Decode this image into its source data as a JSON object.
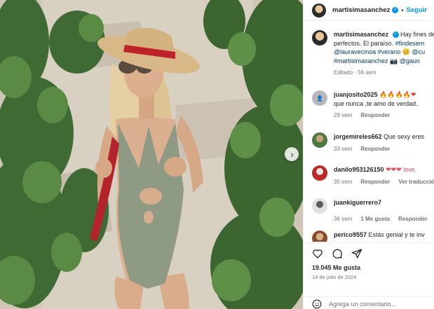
{
  "post": {
    "username": "martisimasanchez",
    "follow_label": "Seguir",
    "dot": "•"
  },
  "comments": [
    {
      "user": "martisimasanchez",
      "text_lines": [
        "Hay fines de",
        "perfectos. El paraíso.",
        "@lauravecinoa #verano",
        "#martisimasanchez"
      ],
      "tags": [
        "#findesem",
        "@cu",
        "@gaun"
      ],
      "emoji": [
        "😊",
        "📷"
      ],
      "time": "Editado · 56 sem",
      "avatar_color": "#3a3a3a"
    },
    {
      "user": "juanjosito2025",
      "text_lines": [
        "🔥🔥🔥🔥❤",
        "que nunca ,te amo de verdad."
      ],
      "time": "29 sem",
      "reply": "Responder",
      "avatar_color": "#b8b8b8"
    },
    {
      "user": "jorgemireles662",
      "text_lines": [
        "Que sexy eres"
      ],
      "time": "33 sem",
      "reply": "Responder",
      "avatar_color": "#4c7a3e"
    },
    {
      "user": "danilo953126150",
      "text_lines": [
        "❤❤❤ love."
      ],
      "time": "35 sem",
      "reply": "Responder",
      "extra": "Ver traducción",
      "avatar_color": "#c02828"
    },
    {
      "user": "juankiguerrero7",
      "text_lines": [
        ""
      ],
      "time": "36 sem",
      "likes": "1 Me gusta",
      "reply": "Responder",
      "avatar_color": "#d9d9d9"
    },
    {
      "user": "perico9557",
      "text_lines": [
        "Estás genial y te inv"
      ],
      "avatar_color": "#8a4a2a"
    }
  ],
  "actions": {
    "likes": "19.045 Me gusta",
    "date": "14 de julio de 2024"
  },
  "add_comment": {
    "placeholder": "Agrega un comentario..."
  },
  "icons": {
    "like": "heart-icon",
    "comment": "comment-icon",
    "share": "share-icon",
    "save": "bookmark-icon",
    "emoji": "emoji-icon",
    "next": "chevron-right-icon",
    "verified": "verified-badge-icon"
  },
  "colors": {
    "accent": "#0095f6",
    "hat_band": "#c0202a",
    "swimsuit": "#8f9a84"
  }
}
